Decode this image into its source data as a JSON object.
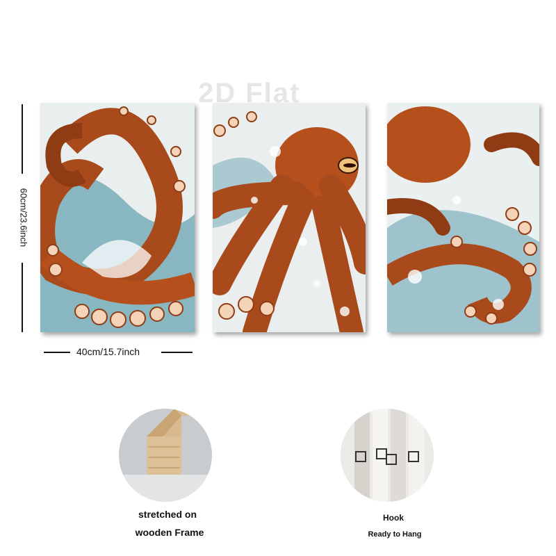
{
  "watermark": "2D Flat",
  "dimensions": {
    "height_label": "60cm/23.6inch",
    "width_label": "40cm/15.7inch"
  },
  "panels": [
    {
      "name": "octopus-tentacle-left-panel"
    },
    {
      "name": "octopus-head-center-panel"
    },
    {
      "name": "octopus-tentacle-right-panel"
    }
  ],
  "features": {
    "frame_caption_line1": "stretched on",
    "frame_caption_line2": "wooden Frame",
    "hook_caption": "Hook",
    "hook_subcaption": "Ready to Hang"
  },
  "colors": {
    "octopus": "#b5501d",
    "octopus_dark": "#6e2a0c",
    "sucker": "#f4d3b8",
    "water": "#5f9fae",
    "foam": "#eef3f3",
    "wood": "#d9b98f"
  }
}
